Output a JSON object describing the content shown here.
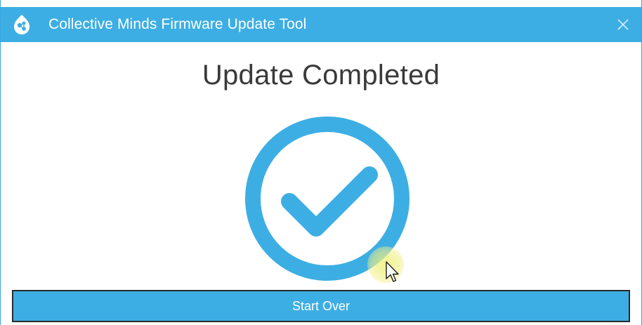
{
  "window": {
    "title": "Collective Minds Firmware Update Tool",
    "app_icon": "collective-minds-logo-icon",
    "close_icon": "close-icon"
  },
  "main": {
    "heading": "Update Completed",
    "status_icon": "check-circle-icon",
    "start_over_label": "Start Over"
  },
  "colors": {
    "accent": "#3daee3",
    "heading_text": "#3a3a3a",
    "button_text": "#ffffff"
  }
}
